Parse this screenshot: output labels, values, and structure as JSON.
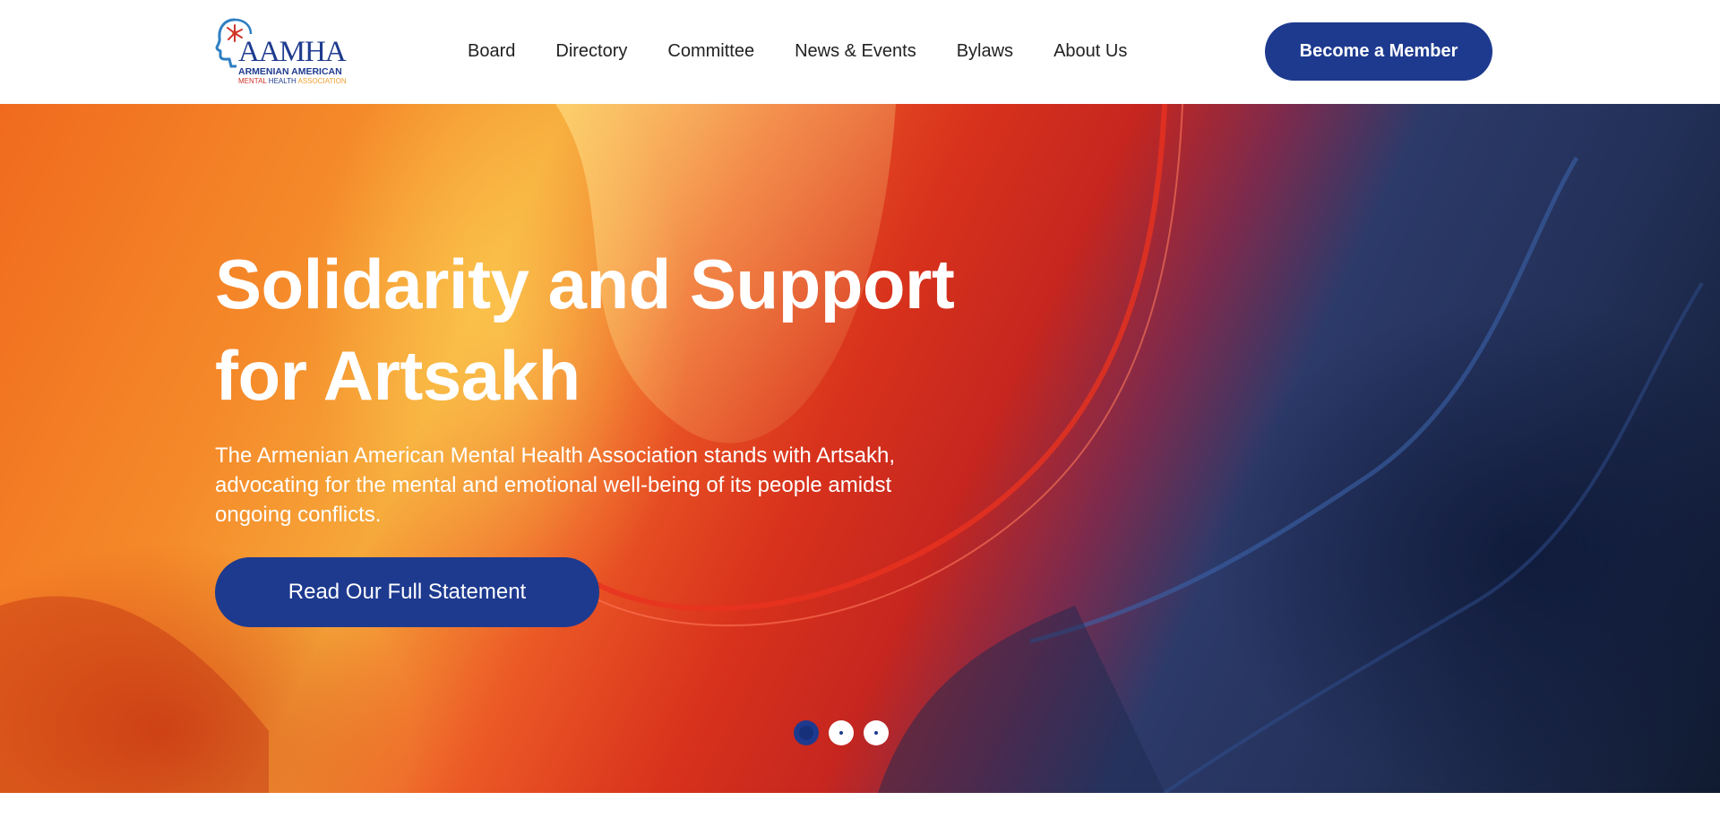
{
  "header": {
    "logo": {
      "wordmark": "AAMHA",
      "line1": "ARMENIAN AMERICAN",
      "line2_part1": "MENTAL",
      "line2_part2": "HEALTH",
      "line2_part3": "ASSOCIATION"
    },
    "nav": [
      "Board",
      "Directory",
      "Committee",
      "News & Events",
      "Bylaws",
      "About Us"
    ],
    "cta_label": "Become a Member"
  },
  "hero": {
    "title": "Solidarity and Support for Artsakh",
    "text": "The Armenian American Mental Health Association stands with Artsakh, advocating for the mental and emotional well-being of its people amidst ongoing conflicts.",
    "cta_label": "Read Our Full Statement",
    "carousel": {
      "slides": 3,
      "active_index": 0
    }
  },
  "colors": {
    "brand_blue": "#1e3a8f",
    "accent_red": "#d0342c",
    "accent_orange": "#f0a030",
    "text_dark": "#222222"
  },
  "icons": [
    "head-profile-logo-icon",
    "carousel-dot-icon"
  ]
}
